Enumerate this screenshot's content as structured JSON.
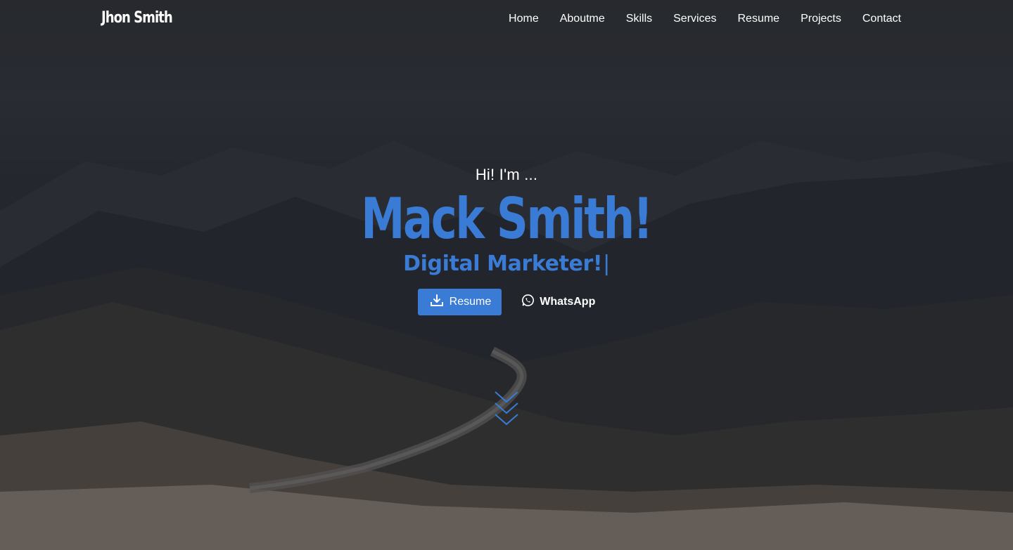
{
  "brand": {
    "logo_text": "Jhon Smith"
  },
  "nav": {
    "items": [
      {
        "label": "Home"
      },
      {
        "label": "Aboutme"
      },
      {
        "label": "Skills"
      },
      {
        "label": "Services"
      },
      {
        "label": "Resume"
      },
      {
        "label": "Projects"
      },
      {
        "label": "Contact"
      }
    ]
  },
  "hero": {
    "greeting": "Hi! I'm ...",
    "name": "Mack Smith!",
    "role": "Digital Marketer!",
    "cursor": "|",
    "resume_button": "Resume",
    "whatsapp_button": "WhatsApp"
  },
  "icons": {
    "download": "download-icon",
    "whatsapp": "whatsapp-icon",
    "scroll": "chevrons-down-icon"
  },
  "colors": {
    "accent": "#3a7bd5",
    "text": "#ffffff",
    "nav_bg": "#2a2c30"
  }
}
